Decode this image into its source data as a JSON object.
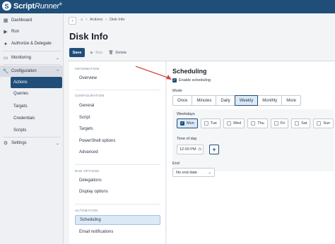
{
  "app": {
    "logo_mark": "S",
    "logo_script": "Script",
    "logo_runner": "Runner",
    "logo_tm": "®"
  },
  "sidebar": {
    "items": [
      {
        "label": "Dashboard",
        "icon": "dashboard-icon"
      },
      {
        "label": "Run",
        "icon": "play-icon"
      },
      {
        "label": "Authorize & Delegate",
        "icon": "user-icon"
      },
      {
        "label": "Monitoring",
        "icon": "monitor-icon"
      },
      {
        "label": "Configuration",
        "icon": "wrench-icon"
      }
    ],
    "config_sub": [
      "Actions",
      "Queries",
      "Targets",
      "Credentials",
      "Scripts"
    ],
    "settings": "Settings"
  },
  "header": {
    "breadcrumb": [
      "Actions",
      "Disk Info"
    ],
    "title": "Disk Info",
    "save": "Save",
    "run": "Run",
    "delete": "Delete"
  },
  "left_panel": {
    "groups": [
      {
        "label": "INFORMATION",
        "items": [
          "Overview"
        ]
      },
      {
        "label": "CONFIGURATION",
        "items": [
          "General",
          "Script",
          "Targets",
          "PowerShell options",
          "Advanced"
        ]
      },
      {
        "label": "RUN OPTIONS",
        "items": [
          "Delegations",
          "Display options"
        ]
      },
      {
        "label": "AUTOMATION",
        "items": [
          "Scheduling",
          "Email notifications"
        ]
      }
    ]
  },
  "scheduling": {
    "title": "Scheduling",
    "enable_label": "Enable scheduling",
    "enabled": true,
    "mode_label": "Mode",
    "modes": [
      "Once",
      "Minutes",
      "Daily",
      "Weekly",
      "Monthly",
      "More"
    ],
    "selected_mode": "Weekly",
    "weekdays_label": "Weekdays",
    "days": [
      {
        "label": "Mon",
        "checked": true
      },
      {
        "label": "Tue",
        "checked": false
      },
      {
        "label": "Wed",
        "checked": false
      },
      {
        "label": "Thu",
        "checked": false
      },
      {
        "label": "Fri",
        "checked": false
      },
      {
        "label": "Sat",
        "checked": false
      },
      {
        "label": "Sun",
        "checked": false
      }
    ],
    "time_label": "Time of day",
    "time_value": "12:00 PM",
    "add": "+",
    "end_label": "End",
    "end_value": "No end date"
  },
  "colors": {
    "brand": "#1f4e79",
    "selected_bg": "#dbe9f6",
    "annotation_arrow": "#d64545"
  }
}
